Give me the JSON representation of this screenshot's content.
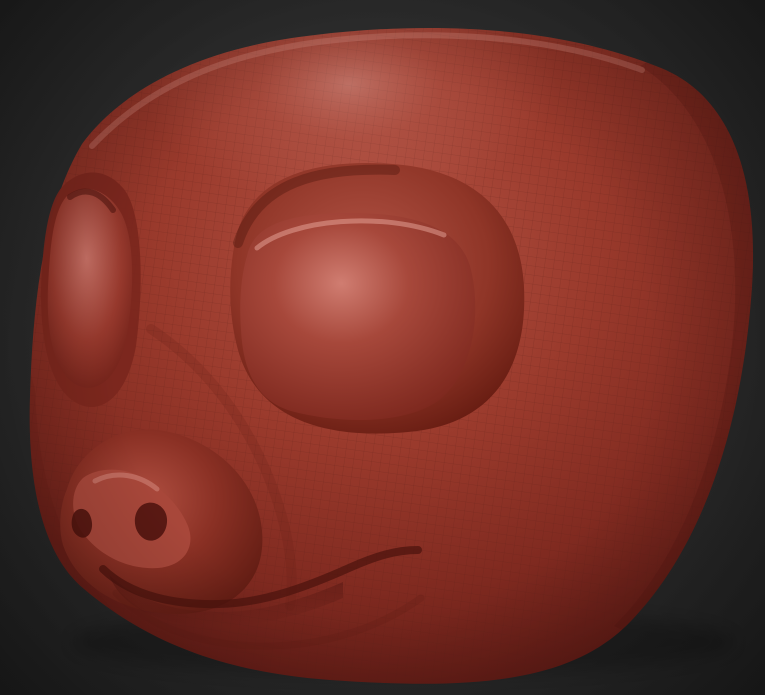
{
  "viewport": {
    "background_color": "#2d2d2d",
    "model_color": "#8f3324",
    "highlight_color": "#d98a7d"
  },
  "model": {
    "icon_name": "sculpt-head-icon"
  }
}
